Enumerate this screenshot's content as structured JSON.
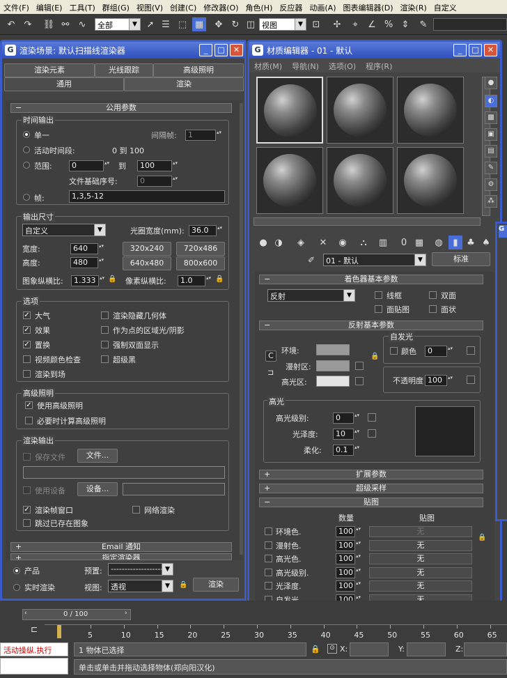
{
  "menubar": [
    "文件(F)",
    "编辑(E)",
    "工具(T)",
    "群组(G)",
    "视图(V)",
    "创建(C)",
    "修改器(O)",
    "角色(H)",
    "反应器",
    "动画(A)",
    "图表编辑器(D)",
    "渲染(R)",
    "自定义"
  ],
  "toolbar": {
    "selection_filter": "全部",
    "view_combo": "视图"
  },
  "render_win": {
    "title": "渲染场景: 默认扫描线渲染器",
    "tabs_row1": [
      "渲染元素",
      "光线跟踪",
      "高级照明"
    ],
    "tabs_row2": [
      "通用",
      "渲染"
    ],
    "common_rollout": "公用参数",
    "time_output": {
      "label": "时间输出",
      "single": "单一",
      "every_nth_label": "间隔帧:",
      "every_nth_value": "1",
      "active_segment": "活动时间段:",
      "active_range": "0 到 100",
      "range": "范围:",
      "range_from": "0",
      "range_to_label": "到",
      "range_to": "100",
      "file_base_label": "文件基础序号:",
      "file_base_value": "0",
      "frames_label": "帧:",
      "frames_value": "1,3,5-12"
    },
    "output_size": {
      "label": "输出尺寸",
      "preset": "自定义",
      "aperture_label": "光圈宽度(mm):",
      "aperture_value": "36.0",
      "width_label": "宽度:",
      "width_value": "640",
      "height_label": "高度:",
      "height_value": "480",
      "presets": [
        "320x240",
        "720x486",
        "640x480",
        "800x600"
      ],
      "image_aspect_label": "图象纵横比:",
      "image_aspect_value": "1.333",
      "pixel_aspect_label": "像素纵横比:",
      "pixel_aspect_value": "1.0"
    },
    "options": {
      "label": "选项",
      "left": [
        {
          "text": "大气",
          "checked": true
        },
        {
          "text": "效果",
          "checked": true
        },
        {
          "text": "置换",
          "checked": true
        },
        {
          "text": "视频颜色检查",
          "checked": false
        },
        {
          "text": "渲染到场",
          "checked": false
        }
      ],
      "right": [
        {
          "text": "渲染隐藏几何体",
          "checked": false
        },
        {
          "text": "作为点的区域光/阴影",
          "checked": false
        },
        {
          "text": "强制双面显示",
          "checked": false
        },
        {
          "text": "超级黑",
          "checked": false
        }
      ]
    },
    "adv_lighting": {
      "label": "高级照明",
      "use": "使用高级照明",
      "compute": "必要时计算高级照明"
    },
    "render_output": {
      "label": "渲染输出",
      "save_file": "保存文件",
      "files_btn": "文件...",
      "use_device": "使用设备",
      "devices_btn": "设备...",
      "frame_window": "渲染帧窗口",
      "net_render": "网络渲染",
      "skip_existing": "跳过已存在图象"
    },
    "email_rollout": "Email 通知",
    "assign_rollout": "指定渲染器",
    "bottom": {
      "production": "产品",
      "activeshade": "实时渲染",
      "preset_label": "预置:",
      "preset_value": "--------------------",
      "view_label": "视图:",
      "view_value": "透视",
      "render_btn": "渲染"
    }
  },
  "mat_win": {
    "title": "材质编辑器 - 01 - 默认",
    "menu": [
      "材质(M)",
      "导航(N)",
      "选项(O)",
      "程序(R)"
    ],
    "mat_name": "01 - 默认",
    "mat_type": "标准",
    "shader_rollout": "着色器基本参数",
    "shader": "反射",
    "shader_checks": [
      "线框",
      "双面",
      "面贴图",
      "面状"
    ],
    "basic_rollout": "反射基本参数",
    "ambient": "环境:",
    "diffuse": "漫射区:",
    "specular": "高光区:",
    "self_illum": "自发光",
    "color_label": "颜色",
    "color_value": "0",
    "opacity_label": "不透明度",
    "opacity_value": "100",
    "spec_label": "高光",
    "spec_level_label": "高光级别:",
    "spec_level": "0",
    "gloss_label": "光泽度:",
    "gloss": "10",
    "soften_label": "柔化:",
    "soften": "0.1",
    "ext_rollout": "扩展参数",
    "ss_rollout": "超级采样",
    "maps_rollout": "贴图",
    "maps_col1": "数量",
    "maps_col2": "贴图",
    "maps": [
      {
        "name": "环境色.",
        "amount": "100",
        "map": "无"
      },
      {
        "name": "漫射色.",
        "amount": "100",
        "map": "无"
      },
      {
        "name": "高光色.",
        "amount": "100",
        "map": "无"
      },
      {
        "name": "高光级别.",
        "amount": "100",
        "map": "无"
      },
      {
        "name": "光泽度.",
        "amount": "100",
        "map": "无"
      },
      {
        "name": "自发光.",
        "amount": "100",
        "map": "无"
      }
    ]
  },
  "timeline": {
    "frame_counter": "0 / 100",
    "ticks": [
      "5",
      "10",
      "15",
      "20",
      "25",
      "30",
      "35",
      "40",
      "45",
      "50",
      "55",
      "60",
      "65"
    ]
  },
  "status": {
    "script": "活动操纵.执行",
    "selected": "1 物体已选择",
    "prompt": "单击或单击并拖动选择物体(郑向阳汉化)",
    "x_label": "X:",
    "y_label": "Y:",
    "z_label": "Z:"
  }
}
